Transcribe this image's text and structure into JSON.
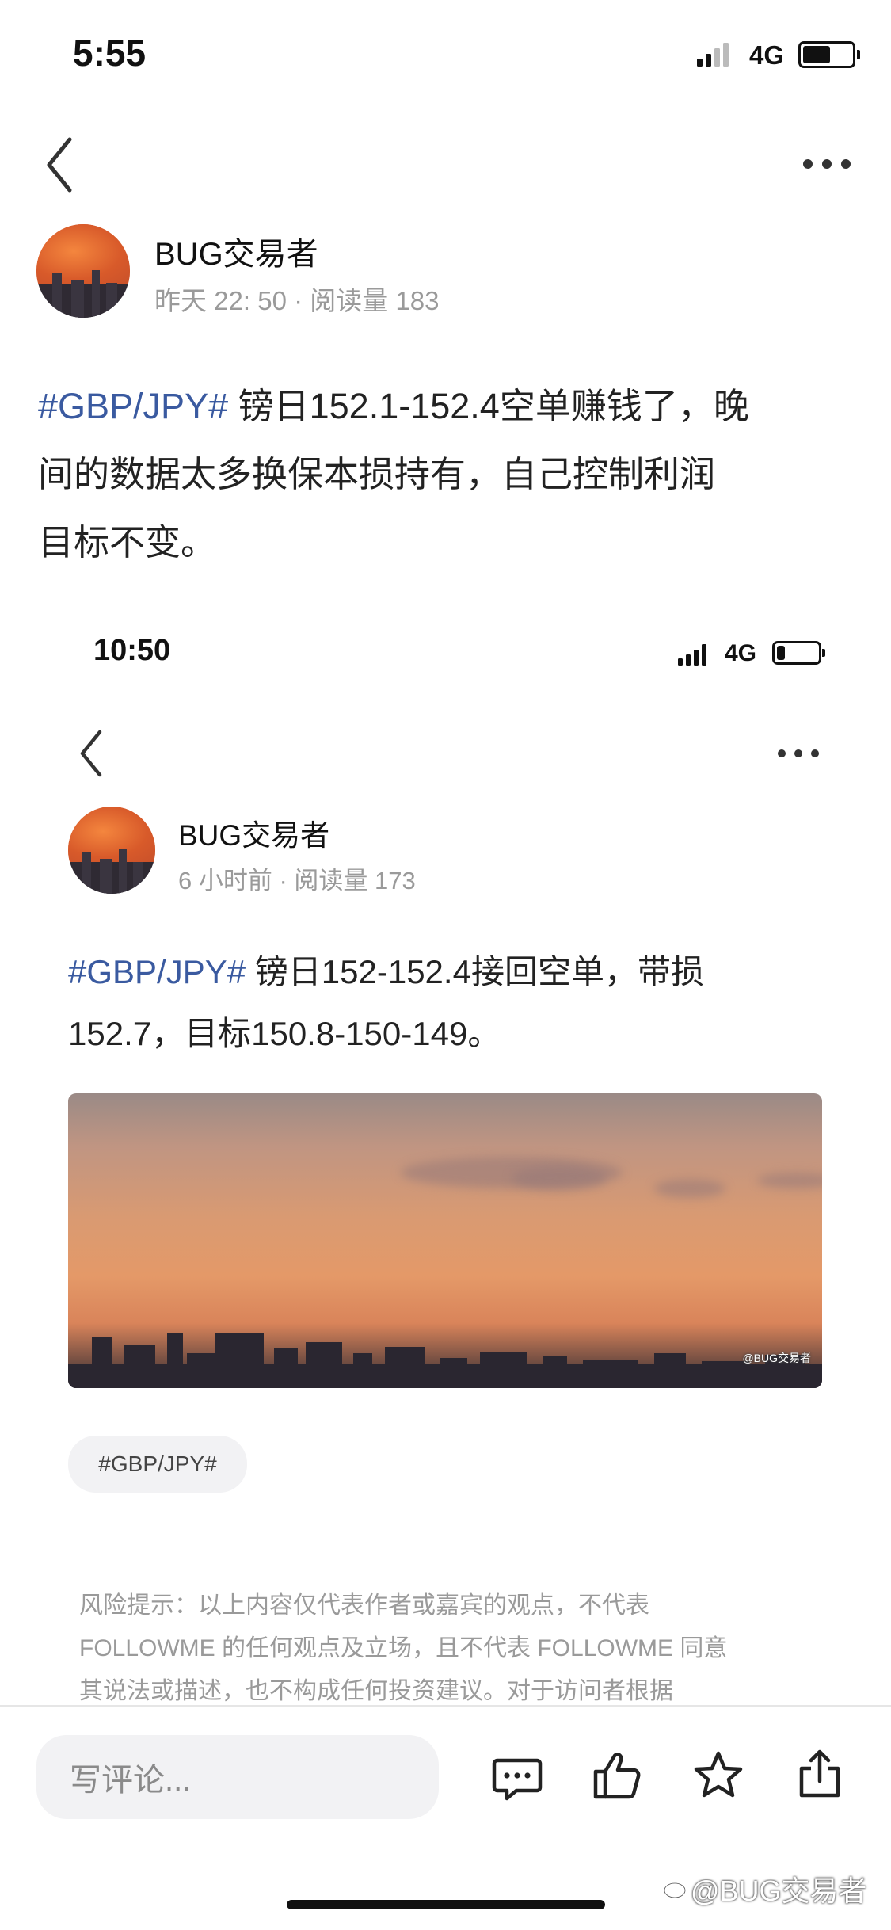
{
  "status_bar": {
    "time": "5:55",
    "network": "4G"
  },
  "post": {
    "author": "BUG交易者",
    "meta": "昨天 22: 50 · 阅读量 183",
    "hashtag": "#GBP/JPY#",
    "line1_rest": " 镑日152.1-152.4空单赚钱了，晚",
    "line2": "间的数据太多换保本损持有，自己控制利润",
    "line3": "目标不变。"
  },
  "embedded": {
    "status_bar": {
      "time": "10:50",
      "network": "4G"
    },
    "author": "BUG交易者",
    "meta": "6 小时前 · 阅读量 173",
    "hashtag": "#GBP/JPY#",
    "line1_rest": " 镑日152-152.4接回空单，带损",
    "line2": "152.7，目标150.8-150-149。",
    "image_watermark": "@BUG交易者",
    "tag_chip": "#GBP/JPY#",
    "disclaimer": {
      "line1": "风险提示：以上内容仅代表作者或嘉宾的观点，不代表",
      "line2": "FOLLOWME 的任何观点及立场，且不代表 FOLLOWME 同意",
      "line3": "其说法或描述，也不构成任何投资建议。对于访问者根据"
    }
  },
  "bottom_bar": {
    "comment_placeholder": "写评论..."
  },
  "watermark": "@BUG交易者",
  "icons": [
    "back-chevron-icon",
    "more-dots-icon",
    "signal-icon",
    "battery-icon",
    "comment-icon",
    "like-icon",
    "favorite-star-icon",
    "share-icon",
    "weibo-logo-icon"
  ],
  "colors": {
    "hashtag": "#3a5aa0",
    "disclaimer": "#9a9a9a",
    "chip_bg": "#f2f2f4"
  }
}
